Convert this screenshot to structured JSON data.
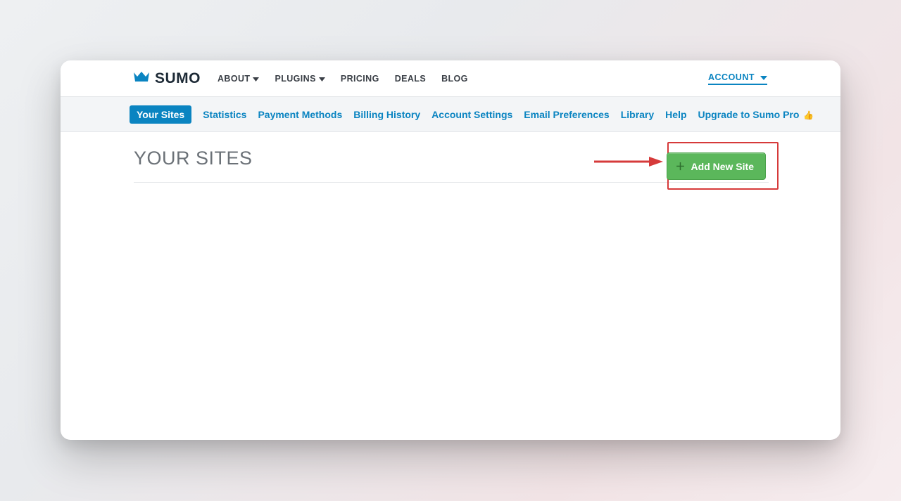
{
  "brand": {
    "name": "SUMO"
  },
  "topnav": {
    "items": [
      {
        "label": "ABOUT",
        "hasCaret": true
      },
      {
        "label": "PLUGINS",
        "hasCaret": true
      },
      {
        "label": "PRICING",
        "hasCaret": false
      },
      {
        "label": "DEALS",
        "hasCaret": false
      },
      {
        "label": "BLOG",
        "hasCaret": false
      }
    ],
    "account_label": "ACCOUNT"
  },
  "tabs": {
    "items": [
      {
        "label": "Your Sites",
        "active": true
      },
      {
        "label": "Statistics",
        "active": false
      },
      {
        "label": "Payment Methods",
        "active": false
      },
      {
        "label": "Billing History",
        "active": false
      },
      {
        "label": "Account Settings",
        "active": false
      },
      {
        "label": "Email Preferences",
        "active": false
      },
      {
        "label": "Library",
        "active": false
      },
      {
        "label": "Help",
        "active": false
      }
    ],
    "upgrade_label": "Upgrade to Sumo Pro"
  },
  "page": {
    "title": "YOUR SITES",
    "add_button_label": "Add New Site"
  }
}
